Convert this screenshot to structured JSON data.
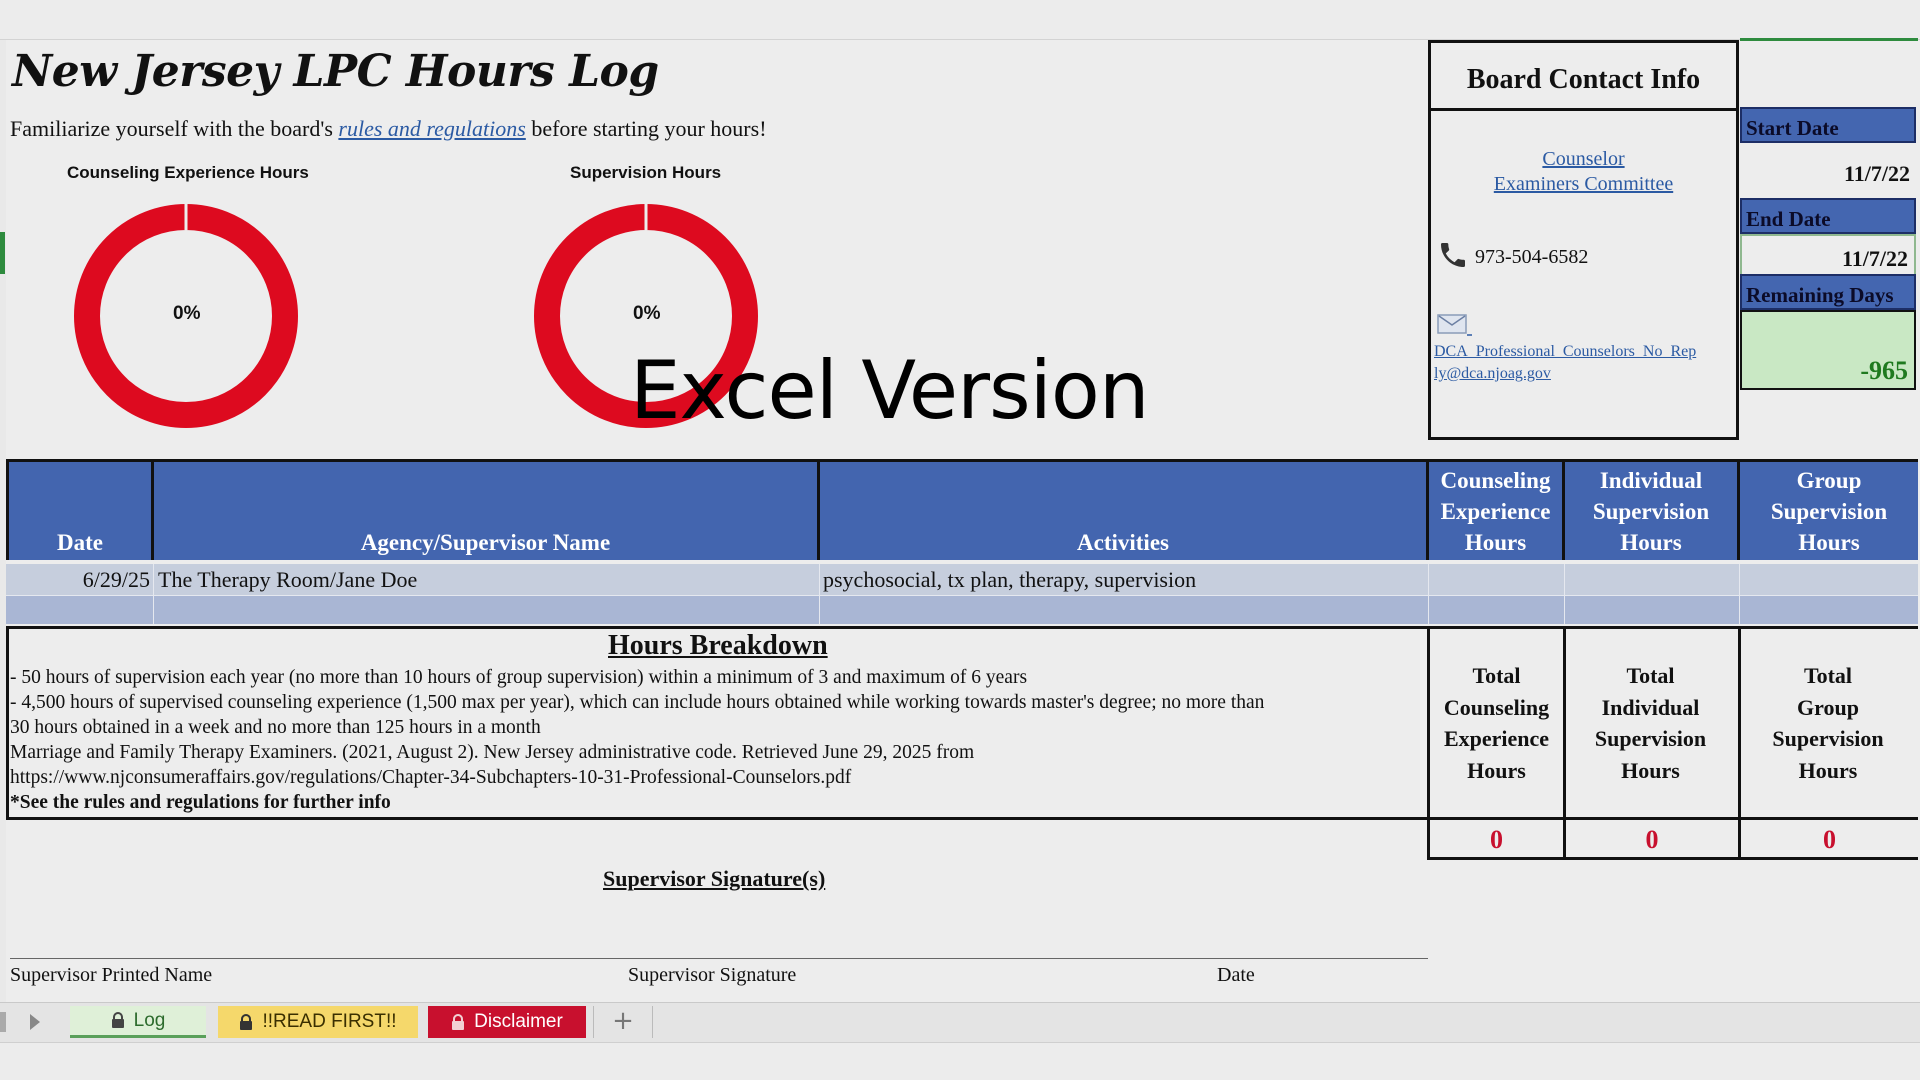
{
  "title": "New Jersey LPC Hours Log",
  "subtitle": {
    "before": "Familiarize yourself with the board's ",
    "link": "rules and regulations",
    "after": " before starting your hours!"
  },
  "donuts": [
    {
      "label": "Counseling Experience Hours",
      "percent_text": "0%",
      "percent": 0
    },
    {
      "label": "Supervision Hours",
      "percent_text": "0%",
      "percent": 0
    }
  ],
  "watermark": "Excel Version",
  "contact": {
    "heading": "Board Contact Info",
    "committee_line1": "Counselor",
    "committee_line2": "Examiners Committee",
    "phone": "973-504-6582",
    "email_line1": "DCA_Professional_Counselors_No_Rep",
    "email_line2": "ly@dca.njoag.gov"
  },
  "dates": {
    "start_label": "Start Date",
    "start_value": "11/7/22",
    "end_label": "End Date",
    "end_value": "11/7/22",
    "remaining_label": "Remaining Days",
    "remaining_value": "-965"
  },
  "table": {
    "headers": {
      "date": "Date",
      "agency": "Agency/Supervisor Name",
      "activities": "Activities",
      "counseling": [
        "Counseling",
        "Experience",
        "Hours"
      ],
      "individual": [
        "Individual",
        "Supervision",
        "Hours"
      ],
      "group": [
        "Group",
        "Supervision",
        "Hours"
      ]
    },
    "rows": [
      {
        "date": "6/29/25",
        "agency": "The Therapy Room/Jane Doe",
        "activities": "psychosocial, tx plan, therapy, supervision",
        "counseling": "",
        "individual": "",
        "group": ""
      }
    ]
  },
  "breakdown": {
    "title": "Hours Breakdown",
    "lines": [
      "- 50 hours of supervision each year (no more than 10 hours of group supervision) within a minimum of 3 and maximum of 6 years",
      "- 4,500 hours of supervised counseling experience (1,500 max per year), which can include hours obtained while working towards master's degree; no more than",
      "30 hours obtained in a week and no more than 125 hours in a month",
      "Marriage and Family Therapy Examiners. (2021, August 2). New Jersey administrative code. Retrieved June 29, 2025 from",
      "https://www.njconsumeraffairs.gov/regulations/Chapter-34-Subchapters-10-31-Professional-Counselors.pdf",
      "*See the rules and regulations for further info"
    ]
  },
  "totals": {
    "counseling": [
      "Total",
      "Counseling",
      "Experience",
      "Hours"
    ],
    "individual": [
      "Total",
      "Individual",
      "Supervision",
      "Hours"
    ],
    "group": [
      "Total",
      "Group",
      "Supervision",
      "Hours"
    ],
    "counseling_value": "0",
    "individual_value": "0",
    "group_value": "0"
  },
  "signature": {
    "title": "Supervisor Signature(s)",
    "printed_name": "Supervisor Printed Name",
    "signature": "Supervisor Signature",
    "date": "Date"
  },
  "tabs": [
    {
      "label": "Log",
      "color": "#dff0d8",
      "text_color": "#2d6b2d"
    },
    {
      "label": "!!READ FIRST!!",
      "color": "#f5d86b",
      "text_color": "#3a2f00"
    },
    {
      "label": "Disclaimer",
      "color": "#c8102e",
      "text_color": "#ffffff"
    }
  ],
  "icons": {
    "phone": "phone-icon",
    "email": "email-icon",
    "lock": "lock-icon",
    "add": "plus-icon"
  },
  "colors": {
    "header_blue": "#4365af",
    "donut_red": "#dd0a1f",
    "total_red": "#c8102e",
    "remaining_green": "#1f7a1f"
  }
}
